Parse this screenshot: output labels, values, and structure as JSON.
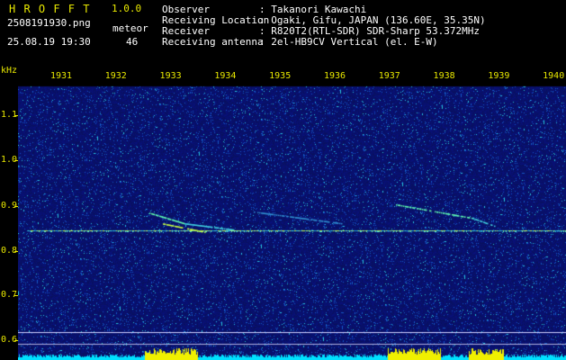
{
  "header": {
    "app_title": "H R O F F T",
    "version": "1.0.0",
    "filename": "2508191930.png",
    "datetime": "25.08.19 19:30",
    "meteor_label": "meteor",
    "meteor_count": "46",
    "fields": [
      {
        "label": "Observer",
        "value": ": Takanori Kawachi"
      },
      {
        "label": "Receiving Location",
        "value": ": Ogaki, Gifu, JAPAN (136.60E, 35.35N)"
      },
      {
        "label": "Receiver",
        "value": ": R820T2(RTL-SDR) SDR-Sharp 53.372MHz"
      },
      {
        "label": "Receiving antenna",
        "value": ": 2el-HB9CV Vertical (el. E-W)"
      }
    ]
  },
  "axes": {
    "unit": "kHz",
    "y_ticks": [
      "1.1",
      "1.0",
      "0.9",
      "0.8",
      "0.7",
      "0.6"
    ],
    "x_ticks": [
      "1931",
      "1932",
      "1933",
      "1934",
      "1935",
      "1936",
      "1937",
      "1938",
      "1939",
      "1940"
    ]
  },
  "colors": {
    "background_signal": "#0a1470",
    "carrier": "#00ffff",
    "text_yellow": "#e8e800",
    "bar_yellow": "#f0f000"
  }
}
